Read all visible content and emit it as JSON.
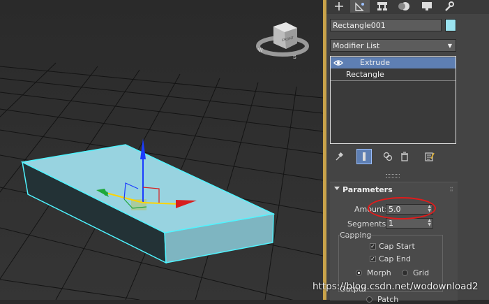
{
  "viewcube": {
    "face_label": "FRONT"
  },
  "panel": {
    "tabs": [
      {
        "name": "create-tab",
        "glyph": "+"
      },
      {
        "name": "modify-tab",
        "glyph": "◿"
      },
      {
        "name": "hierarchy-tab",
        "glyph": "⊞"
      },
      {
        "name": "motion-tab",
        "glyph": "●"
      },
      {
        "name": "display-tab",
        "glyph": "▬"
      },
      {
        "name": "utilities-tab",
        "glyph": "✎"
      }
    ],
    "object_name": "Rectangle001",
    "object_color": "#9be3f0",
    "modifier_list_label": "Modifier List",
    "stack": [
      {
        "label": "Extrude",
        "selected": true
      },
      {
        "label": "Rectangle",
        "selected": false
      }
    ],
    "parameters": {
      "title": "Parameters",
      "amount_label": "Amount:",
      "amount_value": "5.0",
      "segments_label": "Segments:",
      "segments_value": "1",
      "capping_label": "Capping",
      "cap_start_label": "Cap Start",
      "cap_end_label": "Cap End",
      "morph_label": "Morph",
      "grid_label": "Grid",
      "output_label": "Output",
      "patch_label": "Patch"
    }
  },
  "watermark": "https://blog.csdn.net/wodownload2",
  "colors": {
    "accent": "#5e7fb3",
    "annotation": "#e01b1b",
    "object": "#9be3f0"
  }
}
